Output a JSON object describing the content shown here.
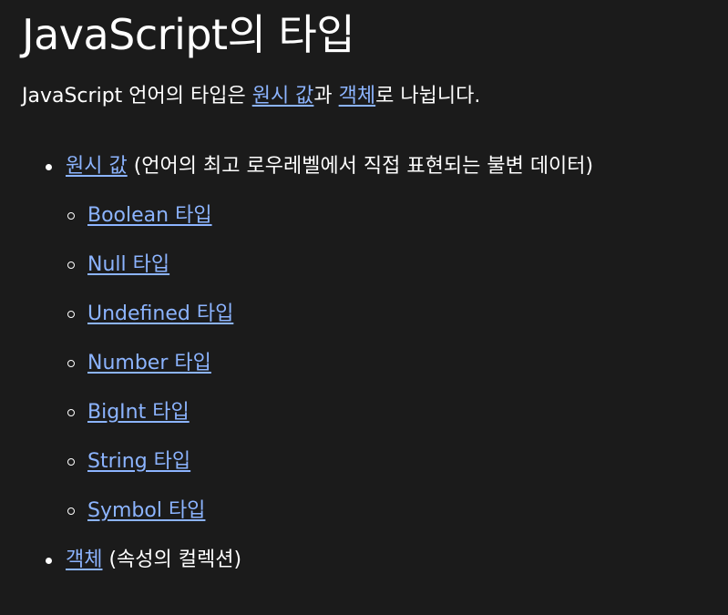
{
  "heading": "JavaScript의 타입",
  "intro": {
    "prefix": "JavaScript 언어의 타입은 ",
    "link1": "원시 값",
    "middle": "과 ",
    "link2": "객체",
    "suffix": "로 나뉩니다."
  },
  "list": {
    "primitive": {
      "link": "원시 값",
      "desc": " (언어의 최고 로우레벨에서 직접 표현되는 불변 데이터)",
      "types": [
        "Boolean 타입",
        "Null 타입",
        "Undefined 타입",
        "Number 타입",
        "BigInt 타입",
        "String 타입",
        "Symbol 타입"
      ]
    },
    "object": {
      "link": "객체",
      "desc": " (속성의 컬렉션)"
    }
  },
  "colors": {
    "background": "#1b1b1b",
    "text": "#ffffff",
    "link": "#8cb4ff"
  }
}
